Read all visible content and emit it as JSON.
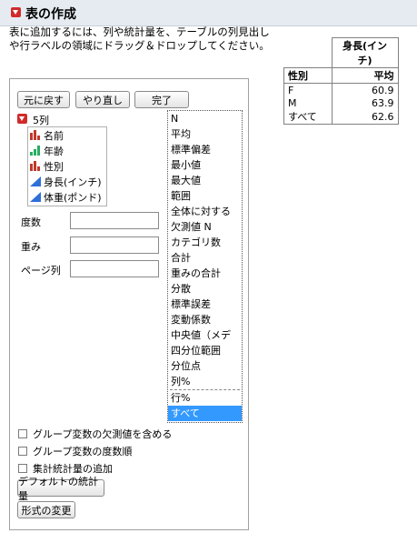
{
  "header": {
    "title": "表の作成"
  },
  "instructions": "表に追加するには、列や統計量を、テーブルの列見出しや行ラベルの領域にドラッグ＆ドロップしてください。",
  "result_table": {
    "column_header": "身長(インチ)",
    "row_header_label": "性別",
    "stat_label": "平均",
    "rows": [
      {
        "label": "F",
        "value": "60.9"
      },
      {
        "label": "M",
        "value": "63.9"
      },
      {
        "label": "すべて",
        "value": "62.6"
      }
    ]
  },
  "toolbar": {
    "undo_label": "元に戻す",
    "redo_label": "やり直し",
    "done_label": "完了"
  },
  "columns_header": "5列",
  "columns": [
    {
      "name": "名前",
      "icon": "nominal-icon",
      "color": "#c0392b"
    },
    {
      "name": "年齢",
      "icon": "ordinal-icon",
      "color": "#27ae60"
    },
    {
      "name": "性別",
      "icon": "nominal-icon",
      "color": "#c0392b"
    },
    {
      "name": "身長(インチ)",
      "icon": "continuous-icon",
      "color": "#2e6fd8"
    },
    {
      "name": "体重(ポンド)",
      "icon": "continuous-icon",
      "color": "#2e6fd8"
    }
  ],
  "fields": {
    "freq_label": "度数",
    "weight_label": "重み",
    "page_label": "ページ列"
  },
  "statistics": [
    "N",
    "平均",
    "標準偏差",
    "最小値",
    "最大値",
    "範囲",
    "全体に対する",
    "欠測値 N",
    "カテゴリ数",
    "合計",
    "重みの合計",
    "分散",
    "標準誤差",
    "変動係数",
    "中央値（メデ",
    "四分位範囲",
    "分位点",
    "列%"
  ],
  "statistics_extra": [
    "行%",
    "すべて"
  ],
  "options": {
    "include_missing": "グループ変数の欠測値を含める",
    "order_by_count": "グループ変数の度数順",
    "add_aggregate": "集計統計量の追加"
  },
  "bottom_buttons": {
    "default_stats": "デフォルトの統計量",
    "change_format": "形式の変更"
  }
}
